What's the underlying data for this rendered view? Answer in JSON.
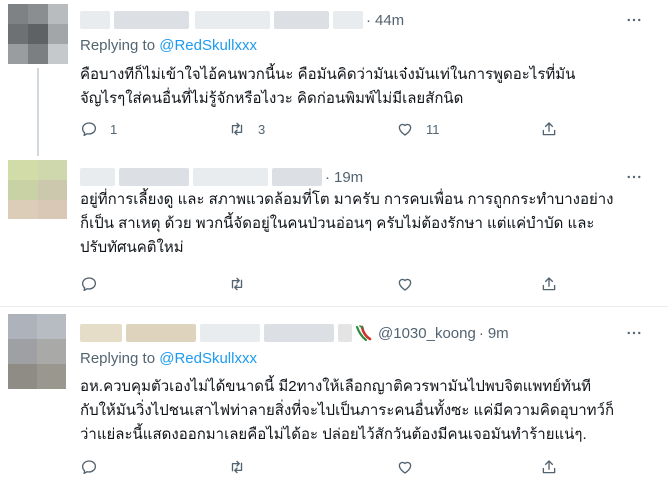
{
  "tweets": [
    {
      "time": "44m",
      "reply_label": "Replying to",
      "reply_mention": "@RedSkullxxx",
      "lines": [
        "คือบางทีก็ไม่เข้าใจไอ้คนพวกนี้นะ คือมันคิดว่ามันเจ๋งมันเท่ในการพูดอะไรที่มัน",
        "จัญไรๆใส่คนอื่นที่ไม่รู้จักหรือไงวะ คิดก่อนพิมพ์ไม่มีเลยสักนิด"
      ],
      "actions": {
        "reply_count": "1",
        "retweet_count": "3",
        "like_count": "11"
      }
    },
    {
      "time": "19m",
      "lines": [
        "อยู่ที่การเลี้ยงดู และ สภาพแวดล้อมที่โต มาครับ การคบเพื่อน การถูกกระทำบางอย่าง",
        "ก็เป็น สาเหตุ ด้วย พวกนี้จัดอยู่ในคนป่วนอ่อนๆ ครับไม่ต้องรักษา แต่แค่บำบัด และ",
        "ปรับทัศนคติใหม่"
      ],
      "actions": {
        "reply_count": "",
        "retweet_count": "",
        "like_count": ""
      }
    },
    {
      "handle": "@1030_koong",
      "time": "9m",
      "reply_label": "Replying to",
      "reply_mention": "@RedSkullxxx",
      "lines": [
        "อห.ควบคุมตัวเองไม่ได้ขนาดนี้ มี2ทางให้เลือกญาติควรพามันไปพบจิตแพทย์ทันที",
        "กับให้มันวิ่งไปชนเสาไฟท่าลายสิ่งที่จะไปเป็นภาระคนอื่นทั้งซะ แค่มีความคิดอุบาทว์ก็",
        "ว่าแย่ละนี้แสดงออกมาเลยคือไม่ได้อะ ปล่อยไว้สักวันต้องมีคนเจอมันทำร้ายแน่ๆ."
      ],
      "actions": {
        "reply_count": "",
        "retweet_count": "",
        "like_count": ""
      }
    }
  ],
  "colors": {
    "link": "#1d9bf0",
    "muted": "#536471",
    "text": "#0f1419",
    "divider": "#e6ecf0"
  },
  "icons": [
    "reply-icon",
    "retweet-icon",
    "like-icon",
    "share-icon",
    "more-icon",
    "chili-emoji-icon"
  ]
}
